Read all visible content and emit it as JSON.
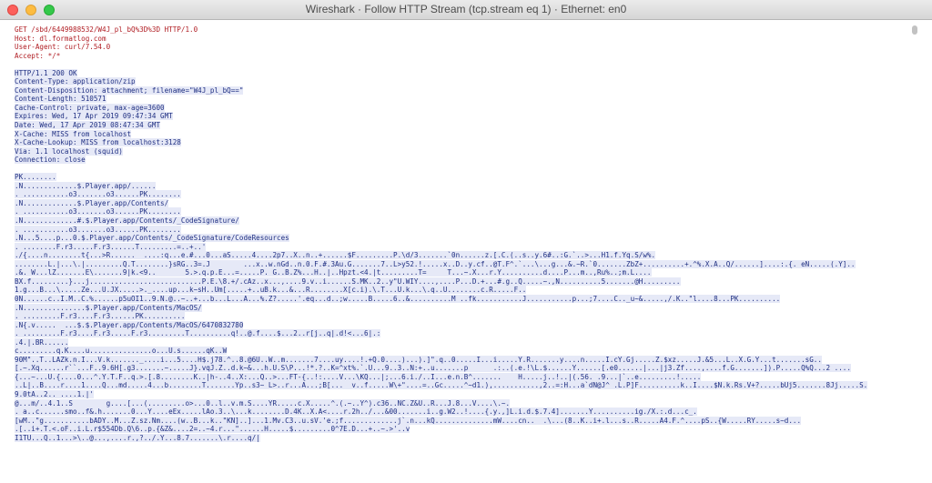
{
  "window": {
    "title": "Wireshark · Follow HTTP Stream (tcp.stream eq 1) · Ethernet: en0"
  },
  "request_lines": [
    "GET /sbd/6449988532/W4J_pl_bQ%3D%3D HTTP/1.0",
    "Host: dl.formatlog.com",
    "User-Agent: curl/7.54.0",
    "Accept: */*"
  ],
  "response_lines": [
    "HTTP/1.1 200 OK",
    "Content-Type: application/zip",
    "Content-Disposition: attachment; filename=\"W4J_pl_bQ==\"",
    "Content-Length: 510571",
    "Cache-Control: private, max-age=3600",
    "Expires: Wed, 17 Apr 2019 09:47:34 GMT",
    "Date: Wed, 17 Apr 2019 08:47:34 GMT",
    "X-Cache: MISS from localhost",
    "X-Cache-Lookup: MISS from localhost:3128",
    "Via: 1.1 localhost (squid)",
    "Connection: close"
  ],
  "binary_lines": [
    "PK........",
    ".N.............$.Player.app/......",
    ". ...........o3.......o3......PK........",
    ".N.............$.Player.app/Contents/",
    ". ...........o3.......o3......PK........",
    ".N.............#.$.Player.app/Contents/_CodeSignature/",
    ". ...........o3.......o3......PK........",
    ".N...5....p...0.$.Player.app/Contents/_CodeSignature/CodeResources",
    ". ........F.r3.....F.r3......T.........=..+..'",
    "./{....n........t{...>R......  ....:q...e.#...0...aS.....4....2p7..X..n..+......$F.........P.\\d/3.......`0n......z.[.C.(..s..y.6#..:G.`..>...H1.f.Yq.S/w%.",
    "........L.|...\\.|.........Q.T........}sRG..3=.J        ...x..w.nGd..n.0.F.#.3Au.G.......7..L>y52.!.....x..D..y.cf..@T.F^.`...\\...g...&.~R.`0.......ZbZ+..........+.^%.X.A..Q/......]....:.{. eN.....(.Y]..",
    ".&. W...lZ.......E\\.......9|k.<9..       5.>.q.p.E...=.....P. G..B.Z%...H..|..Hpzt.<4.|t.........T=     T...~.X...r.Y..........d....P...m..,Ru%..;m.L....",
    "BX.f.........}...j...........................P.E.\\8.+/.cAz..x...,....9.v..i......S.MK..2..y\"U.WIY....,....P...D.+...#.g..Q.....~.,N..........5.......@H.........",
    "1.g...B...\\.....Ze...U.JX.....>._....up...k~sH..Um[.....+..uB.k...&...R........X[c.i).\\.T...U.k...\\.q..U........c.R.....F..",
    "0N......c..I.M..C.%......p5uOI1..9.N.@..~..+...b...L...A...%.Z?.....'.eq...d..;w.....B.....6..&..........M ..fk...........J...........p...;7....C.._u~&.....,/.K..\"l....8...PK..........",
    ".N...............$.Player.app/Contents/MacOS/",
    ". .........F.r3....F.r3......PK..........",
    ".N{.v.....  ...$.$.Player.app/Contents/MacOS/6470832780",
    ". .........F.r3....F.r3.....F.r3.........T..........q!..@.f....$...2..r[j..q|.d!<...6|.:",
    ".4.|.BR......",
    "c.........q.K....u...............o...U.s......qK..W",
    "90M\"..T..LAZk.n.I...V.k......._....i...5....H$.j78.^..8.@6U..W..m.......7....uy....!.+Q.0....)...).]\".q..0.....I...i.....Y.R.......y....n.....I.cY.Gj.....Z.$xz.....J.&5...L..X.G.Y...t.......sG..",
    "[.~.Xq......r``...F..9.6H[.g3.......~.....J}.vqJ.Z..d.k~&...h.U.S\\P...!*.?..K=^xt%.`.U...9..3..N:+..u.......p      .:..(.e.!\\L.$......Y......[.e0......|...|j3.Zf....,....f.G.......]).P.....Q%Q...2 ....",
    "{...~...U.{....0...^.Y.T.F..q.>.[.8........K..|h-..4..X:...Q..>...FT-{..!:....V...\\KQ...|;...6.i./..I...e.n.B^.......    H.....j..!..|(.56. .9...|`..e.........!.....",
    "..L|..B....r....1....Q...md.....4...b........T.......Yp..s3~ L>..r...A...;B[...  v..f.....W\\+\"....=..Gc.....^~d1.),...........,2..=:H...a`dN@J^ .L.P]F..........k..I....$N.k.Rs.V+?.....bUj5.......8Jj.....S.",
    "9.0tA..2.. ....1.|'",
    "@...m/..4.1..S        g....[...(.........o>...0..l..v.m.S....YR.....c.X.....^.(.~..Y^).c36..NC.Z&U..R...J.8...V....\\.~.",
    ". a..c......smo..f&.h.......0...Y....eEx.....lAo.3..\\...k........D.4K..X.A<....r.2h../...&00.......i..g.W2..!....{.y.,]L.i.d.$.7.4].......Y..........ig./X.:.d...c_.",
    "[wM..\"g...........bADY..M...Z.sz.Nm....(w..B...k..\"KN]..]...1.Mv.C3..u.sV.'e.;f.............j`.n...kQ..............mW....cn..  .\\...(8..K..i+.l...s..R.....A4.F.^....pS..{W.....RY.....s~d...",
    ".[..i+.T.<.oF..i.L.r$554Db.Q\\6..p.{&Z&....2=..~4.r...\"......H.....$.........0^7E.D...+..~.>'..v",
    "I1TU...Q..1...>\\..@...,....r.,?../.Y...8.7.......\\.r....q/|"
  ]
}
